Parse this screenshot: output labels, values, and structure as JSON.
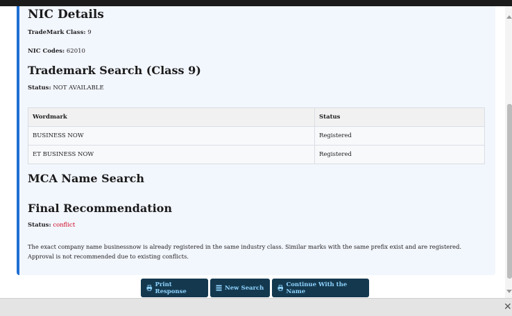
{
  "nic": {
    "heading": "NIC Details",
    "trademark_class_label": "TradeMark Class:",
    "trademark_class_value": "9",
    "nic_codes_label": "NIC Codes:",
    "nic_codes_value": "62010"
  },
  "trademark_search": {
    "heading": "Trademark Search (Class 9)",
    "status_label": "Status:",
    "status_value": "NOT AVAILABLE",
    "columns": [
      "Wordmark",
      "Status"
    ],
    "rows": [
      {
        "wordmark": "BUSINESS NOW",
        "status": "Registered"
      },
      {
        "wordmark": "ET BUSINESS NOW",
        "status": "Registered"
      }
    ]
  },
  "mca": {
    "heading": "MCA Name Search"
  },
  "final": {
    "heading": "Final Recommendation",
    "status_label": "Status:",
    "status_value": "conflict",
    "status_color": "#d0021b",
    "description": "The exact company name businessnow is already registered in the same industry class. Similar marks with the same prefix exist and are registered. Approval is not recommended due to existing conflicts."
  },
  "buttons": {
    "print": {
      "label": "Print Response",
      "icon": "print-icon"
    },
    "new_search": {
      "label": "New Search",
      "icon": "list-icon"
    },
    "continue": {
      "label": "Continue With the Name",
      "icon": "print-icon"
    }
  },
  "colors": {
    "accent": "#1e6fd4",
    "button_bg": "#14394f",
    "button_text": "#8fd4ff",
    "card_bg": "#f2f6fd"
  }
}
